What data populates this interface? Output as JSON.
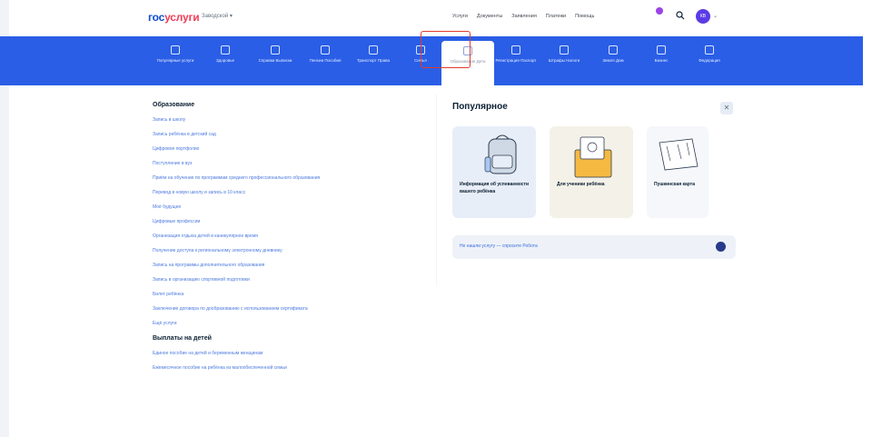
{
  "header": {
    "logo_part1": "гос",
    "logo_part2": "услуги",
    "region": "Заводской ▾",
    "nav": [
      "Услуги",
      "Документы",
      "Заявления",
      "Платежи",
      "Помощь"
    ],
    "avatar_initials": "КВ"
  },
  "menu": {
    "items": [
      {
        "label": "Популярные услуги"
      },
      {
        "label": "Здоровье"
      },
      {
        "label": "Справки Выписки"
      },
      {
        "label": "Пенсии Пособия"
      },
      {
        "label": "Транспорт Права"
      },
      {
        "label": "Семья"
      },
      {
        "label": "Образование Дети"
      },
      {
        "label": "Регистрация Паспорт"
      },
      {
        "label": "Штрафы Налоги"
      },
      {
        "label": "Земля Дом"
      },
      {
        "label": "Бизнес"
      },
      {
        "label": "Федерация"
      }
    ],
    "active_index": 6
  },
  "left": {
    "section1_title": "Образование",
    "section1_links": [
      "Запись в школу",
      "Запись ребёнка в детский сад",
      "Цифровое портфолио",
      "Поступление в вуз",
      "Приём на обучение по программам среднего профессионального образования",
      "Перевод в новую школу и запись в 10 класс",
      "Моё будущее",
      "Цифровые профессии",
      "Организация отдыха детей в каникулярное время",
      "Получение доступа к региональному электронному дневнику",
      "Запись на программы дополнительного образования",
      "Запись в организацию спортивной подготовки",
      "Билет ребёнка",
      "Заключение договора по дообразованию с использованием сертификата",
      "Ещё услуги"
    ],
    "section2_title": "Выплаты на детей",
    "section2_links": [
      "Единое пособие на детей и беременным женщинам",
      "Ежемесячное пособие на ребёнка из малообеспеченной семьи"
    ]
  },
  "popular": {
    "title": "Популярное",
    "cards": [
      {
        "label": "Информация об успеваемости вашего ребёнка"
      },
      {
        "label": "Для ученики ребёнка"
      },
      {
        "label": "Пушкинская карта"
      }
    ],
    "help_text": "Не нашли услугу — спросите Робота",
    "colors": {
      "accent": "#2a5ee6",
      "brand_red": "#ee3f58"
    }
  }
}
